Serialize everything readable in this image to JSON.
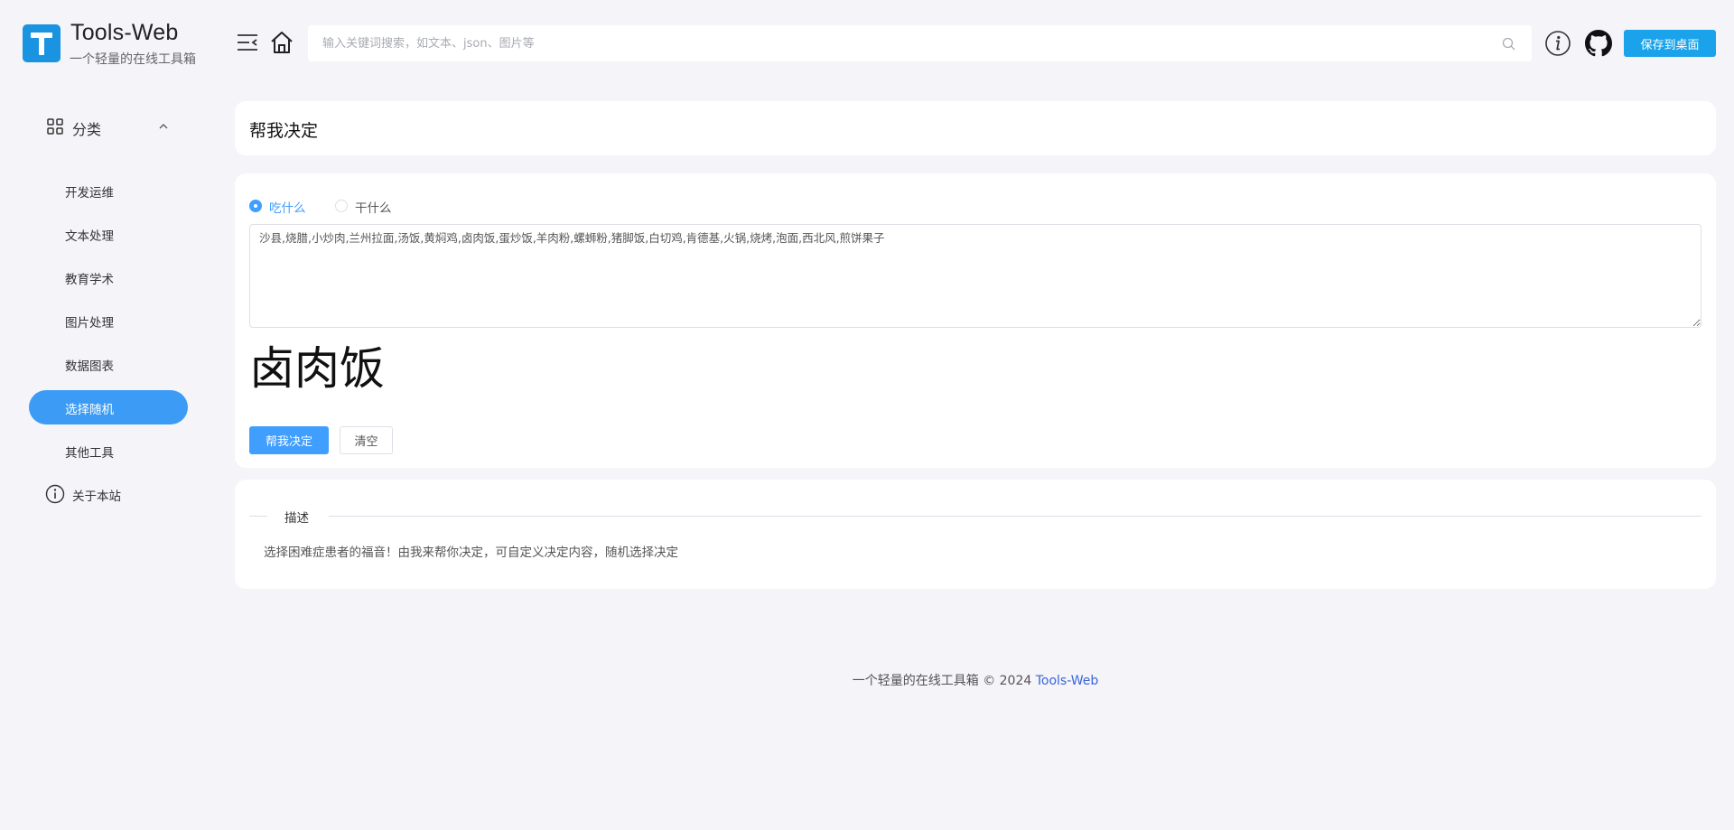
{
  "brand": {
    "title": "Tools-Web",
    "subtitle": "一个轻量的在线工具箱",
    "logo_letter": "T",
    "accent_color": "#1a93e0"
  },
  "header": {
    "search_placeholder": "输入关键词搜索，如文本、json、图片等",
    "search_value": "",
    "save_button": "保存到桌面",
    "icons": [
      "menu-fold-icon",
      "home-icon",
      "search-icon",
      "info-icon",
      "github-icon"
    ]
  },
  "sidebar": {
    "category_label": "分类",
    "items": [
      {
        "label": "开发运维",
        "active": false
      },
      {
        "label": "文本处理",
        "active": false
      },
      {
        "label": "教育学术",
        "active": false
      },
      {
        "label": "图片处理",
        "active": false
      },
      {
        "label": "数据图表",
        "active": false
      },
      {
        "label": "选择随机",
        "active": true
      },
      {
        "label": "其他工具",
        "active": false
      }
    ],
    "about_label": "关于本站",
    "active_color": "#3c9cf5"
  },
  "page": {
    "title": "帮我决定"
  },
  "tool": {
    "radio_options": [
      {
        "label": "吃什么",
        "checked": true
      },
      {
        "label": "干什么",
        "checked": false
      }
    ],
    "options_text": "沙县,烧腊,小炒肉,兰州拉面,汤饭,黄焖鸡,卤肉饭,蛋炒饭,羊肉粉,螺蛳粉,猪脚饭,白切鸡,肯德基,火锅,烧烤,泡面,西北风,煎饼果子",
    "result": "卤肉饭",
    "decide_button": "帮我决定",
    "clear_button": "清空"
  },
  "description": {
    "heading": "描述",
    "text": "选择困难症患者的福音！由我来帮你决定，可自定义决定内容，随机选择决定"
  },
  "footer": {
    "text": "一个轻量的在线工具箱 © 2024 ",
    "link": "Tools-Web"
  }
}
